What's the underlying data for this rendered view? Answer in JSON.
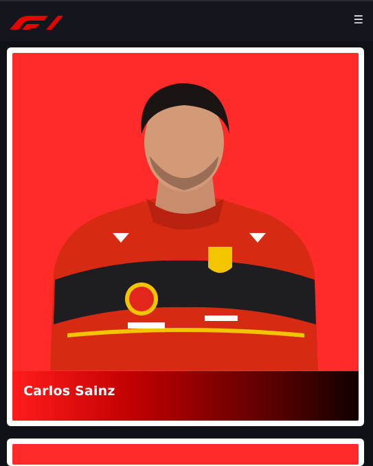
{
  "header": {
    "logo_icon": "f1-logo-icon",
    "menu_icon": "menu-icon",
    "menu_glyph": "☰"
  },
  "colors": {
    "brand_red": "#e10600",
    "card_background": "#ff2a2a",
    "navbar": "#15151e"
  },
  "drivers": [
    {
      "name": "Carlos Sainz"
    }
  ]
}
